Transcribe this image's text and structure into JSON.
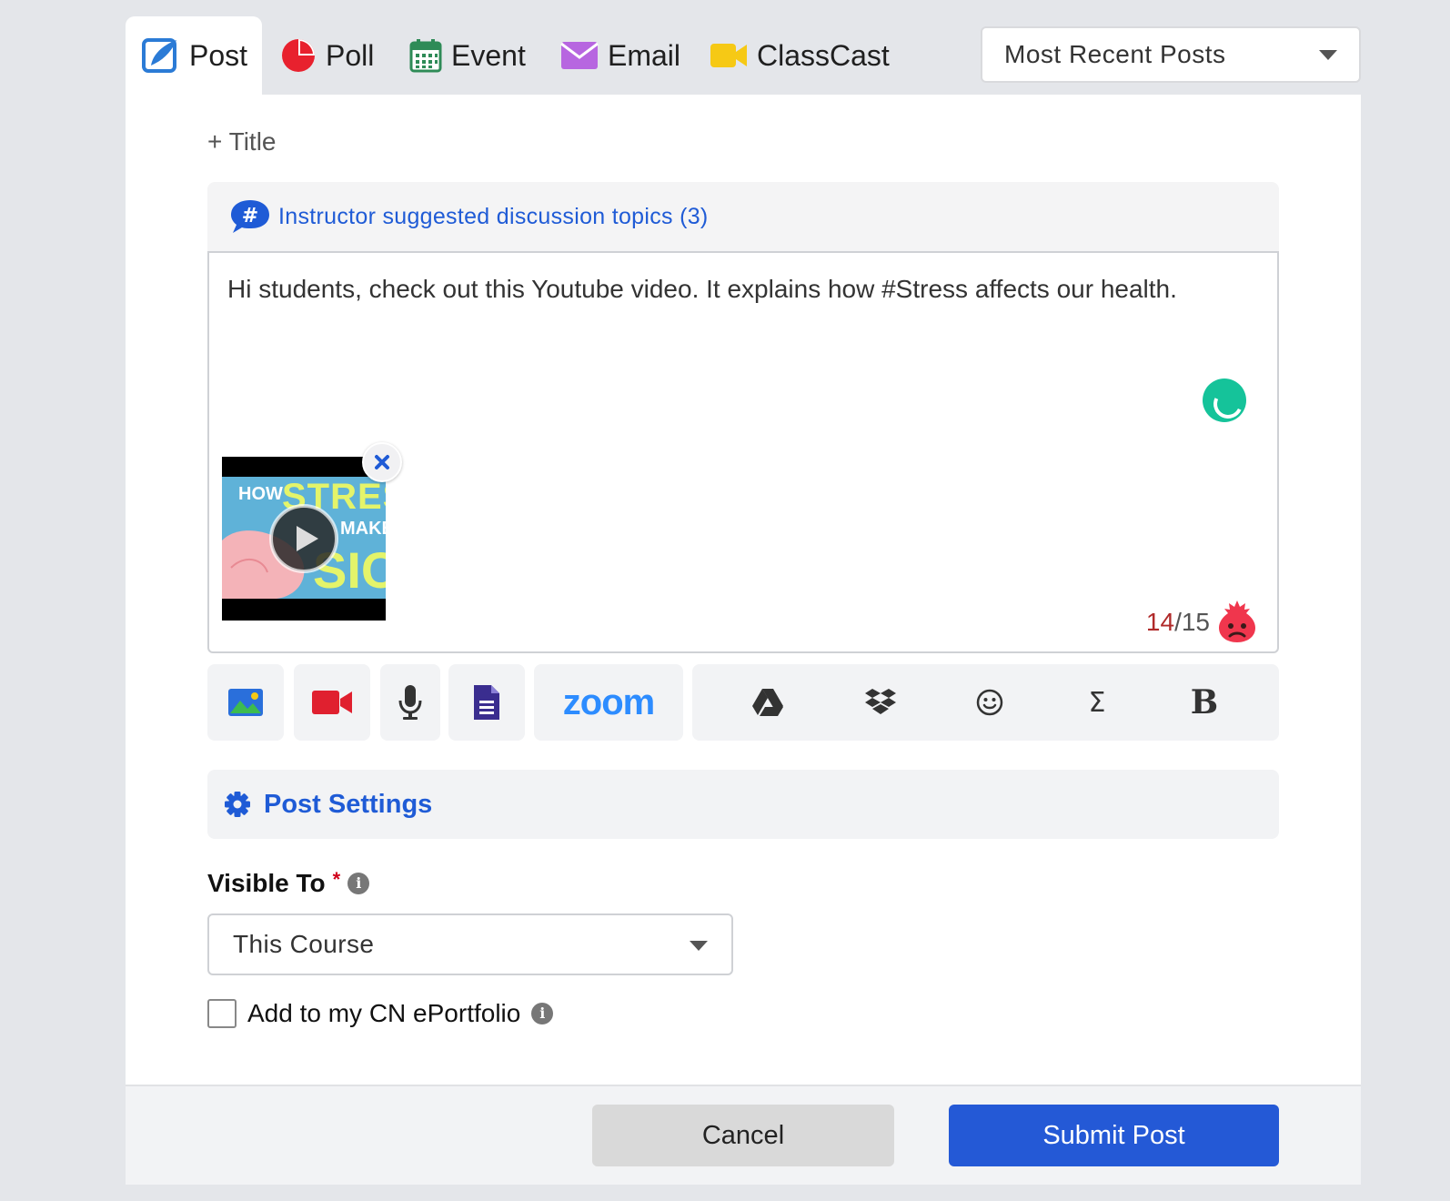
{
  "tabs": [
    {
      "label": "Post",
      "icon": "post-icon",
      "active": true
    },
    {
      "label": "Poll",
      "icon": "poll-icon"
    },
    {
      "label": "Event",
      "icon": "calendar-icon"
    },
    {
      "label": "Email",
      "icon": "envelope-icon"
    },
    {
      "label": "ClassCast",
      "icon": "video-camera-icon"
    }
  ],
  "sort": {
    "selected": "Most Recent Posts"
  },
  "composer": {
    "add_title": "+ Title",
    "topics_link": "Instructor suggested discussion topics (3)",
    "body_text": "Hi students, check out this Youtube video. It explains how #Stress affects our health.",
    "video_thumbnail": {
      "line1": "HOW",
      "line2": "STRES",
      "line3": "MAKE",
      "line4": "SIC"
    },
    "counter_current": "14",
    "counter_separator": "/",
    "counter_total": "15"
  },
  "toolbar": {
    "zoom_label": "zoom",
    "bold_label": "B",
    "sigma_label": "Σ"
  },
  "settings": {
    "label": "Post Settings"
  },
  "visibility": {
    "label": "Visible To",
    "required_mark": "*",
    "selected": "This Course"
  },
  "eportfolio": {
    "label": "Add to my CN ePortfolio",
    "checked": false
  },
  "actions": {
    "cancel_label": "Cancel",
    "submit_label": "Submit Post"
  },
  "colors": {
    "accent": "#2459d6",
    "tab_underline": "#d0021b",
    "link": "#1f5bd6"
  }
}
